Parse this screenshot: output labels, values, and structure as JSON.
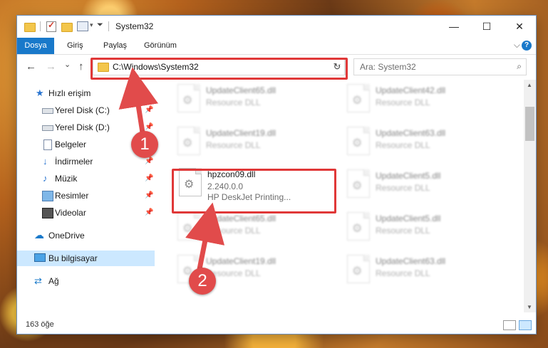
{
  "window": {
    "title": "System32",
    "minimize_glyph": "—",
    "maximize_glyph": "☐",
    "close_glyph": "✕"
  },
  "ribbon": {
    "tabs": [
      "Dosya",
      "Giriş",
      "Paylaş",
      "Görünüm"
    ],
    "expand_glyph": "⌵",
    "help_glyph": "?"
  },
  "navigation": {
    "back_glyph": "←",
    "forward_glyph": "→",
    "recent_glyph": "⌄",
    "up_glyph": "↑",
    "address": "C:\\Windows\\System32",
    "address_dropdown_glyph": "⌵",
    "refresh_glyph": "↻",
    "search_placeholder": "Ara: System32",
    "search_glyph": "⌕"
  },
  "sidebar": {
    "pin_glyph": "📌",
    "items": [
      {
        "label": "Hızlı erişim",
        "icon": "star-icon",
        "glyph": "★"
      },
      {
        "label": "Yerel Disk (C:)",
        "icon": "drive-icon",
        "pinned": true
      },
      {
        "label": "Yerel Disk (D:)",
        "icon": "drive-icon",
        "pinned": true
      },
      {
        "label": "Belgeler",
        "icon": "document-icon",
        "pinned": true
      },
      {
        "label": "İndirmeler",
        "icon": "download-icon",
        "glyph": "↓",
        "pinned": true
      },
      {
        "label": "Müzik",
        "icon": "music-icon",
        "glyph": "♪",
        "pinned": true
      },
      {
        "label": "Resimler",
        "icon": "pictures-icon",
        "pinned": true
      },
      {
        "label": "Videolar",
        "icon": "videos-icon",
        "pinned": true
      },
      {
        "label": "OneDrive",
        "icon": "cloud-icon",
        "glyph": "☁"
      },
      {
        "label": "Bu bilgisayar",
        "icon": "computer-icon",
        "selected": true
      },
      {
        "label": "Ağ",
        "icon": "network-icon",
        "glyph": "⇄"
      }
    ]
  },
  "files": [
    {
      "name": "UpdateClient65.dll",
      "sub": "Resource DLL",
      "blurred": true
    },
    {
      "name": "UpdateClient42.dll",
      "sub": "Resource DLL",
      "blurred": true
    },
    {
      "name": "UpdateClient19.dll",
      "sub": "Resource DLL",
      "blurred": true
    },
    {
      "name": "UpdateClient63.dll",
      "sub": "Resource DLL",
      "blurred": true
    },
    {
      "name": "hpzcon09.dll",
      "sub": "2.240.0.0",
      "sub2": "HP DeskJet Printing...",
      "blurred": false
    },
    {
      "name": "UpdateClient5.dll",
      "sub": "Resource DLL",
      "blurred": true
    },
    {
      "name": "UpdateClient65.dll",
      "sub": "Resource DLL",
      "blurred": true
    },
    {
      "name": "UpdateClient5.dll",
      "sub": "Resource DLL",
      "blurred": true
    },
    {
      "name": "UpdateClient19.dll",
      "sub": "Resource DLL",
      "blurred": true
    },
    {
      "name": "UpdateClient63.dll",
      "sub": "Resource DLL",
      "blurred": true
    }
  ],
  "scrollbar": {
    "up_glyph": "▲",
    "down_glyph": "▼"
  },
  "status": {
    "count": "163 öğe"
  },
  "callouts": [
    {
      "number": "1",
      "color": "#e14b4b"
    },
    {
      "number": "2",
      "color": "#e14b4b"
    }
  ],
  "colors": {
    "accent": "#1979ca",
    "highlight": "#e03838",
    "selected_bg": "#cce8ff"
  }
}
